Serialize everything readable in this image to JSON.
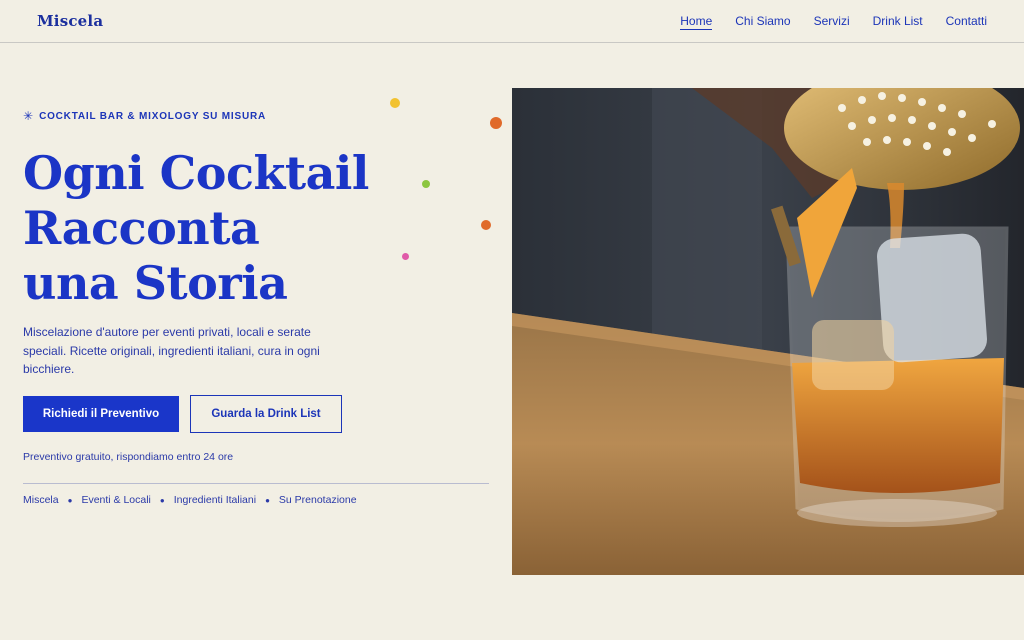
{
  "header": {
    "logo": "Miscela",
    "nav": [
      {
        "label": "Home",
        "active": true
      },
      {
        "label": "Chi Siamo"
      },
      {
        "label": "Servizi"
      },
      {
        "label": "Drink List"
      },
      {
        "label": "Contatti"
      }
    ]
  },
  "hero": {
    "eyebrow": "COCKTAIL BAR & MIXOLOGY SU MISURA",
    "eyebrow_icon": "sparkle-icon",
    "title_lines": [
      "Ogni Cocktail",
      "Racconta",
      "una Storia"
    ],
    "lede": "Miscelazione d'autore per eventi privati, locali e serate speciali. Ricette originali, ingredienti italiani, cura in ogni bicchiere.",
    "primary_cta": "Richiedi il Preventivo",
    "secondary_cta": "Guarda la Drink List",
    "note": "Preventivo gratuito, rispondiamo entro 24 ore",
    "tags": [
      "Miscela",
      "Eventi & Locali",
      "Ingredienti Italiani",
      "Su Prenotazione"
    ]
  },
  "colors": {
    "background": "#f2efe4",
    "accent": "#1a36c9",
    "confetti": [
      "#f2c230",
      "#e06a2a",
      "#8cc63f",
      "#e06a2a",
      "#e05aa8"
    ]
  }
}
